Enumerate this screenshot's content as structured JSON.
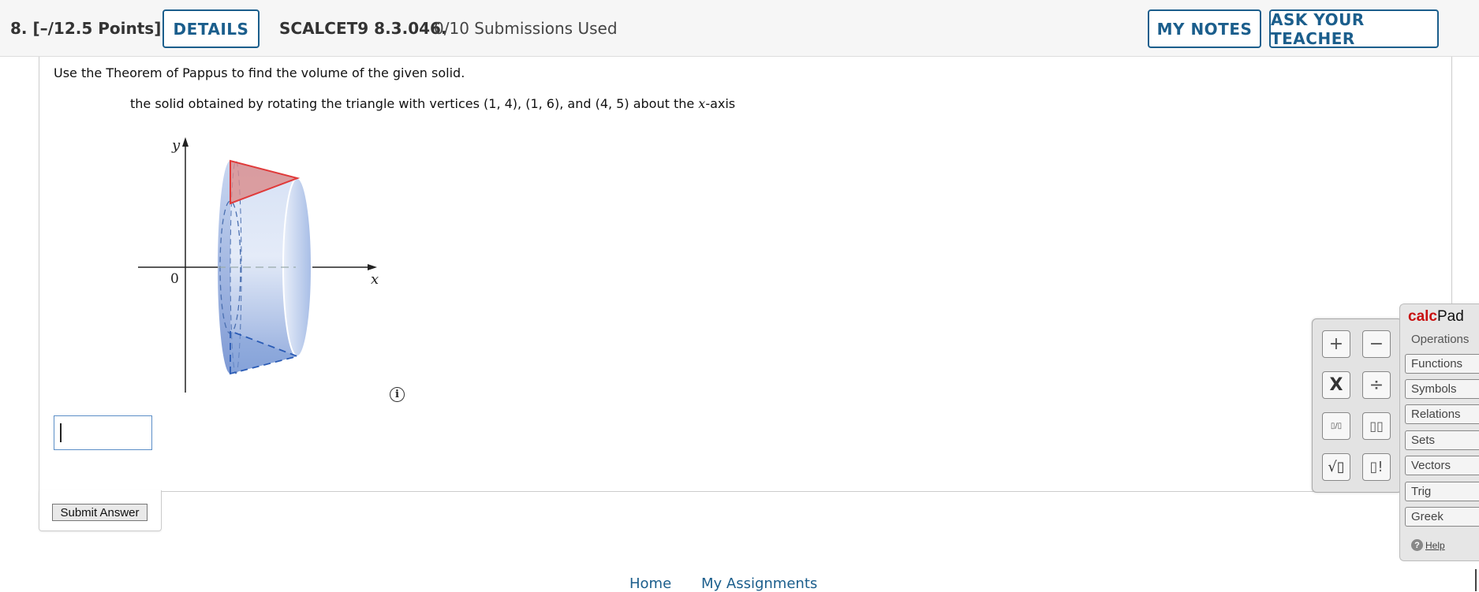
{
  "question": {
    "number_points": "8.  [–/12.5 Points]",
    "details_label": "DETAILS",
    "code": "SCALCET9 8.3.046.",
    "submissions": "0/10 Submissions Used",
    "my_notes_label": "MY NOTES",
    "ask_teacher_label": "ASK YOUR TEACHER"
  },
  "problem": {
    "instruction": "Use the Theorem of Pappus to find the volume of the given solid.",
    "statement_pre": "the solid obtained by rotating the triangle with vertices (1, 4), (1, 6), and (4, 5) about the ",
    "statement_var": "x",
    "statement_post": "-axis"
  },
  "figure": {
    "y_label": "y",
    "x_label": "x",
    "origin_label": "0"
  },
  "answer": {
    "value": ""
  },
  "submit_label": "Submit Answer",
  "footer": {
    "home": "Home",
    "assignments": "My Assignments"
  },
  "keypad": {
    "keys": [
      "+",
      "−",
      "X",
      "÷",
      "▯/▯",
      "▯▯",
      "√▯",
      "▯!"
    ]
  },
  "calcpad": {
    "title_bold": "calc",
    "title_rest": "Pad",
    "operations": "Operations",
    "items": [
      "Functions",
      "Symbols",
      "Relations",
      "Sets",
      "Vectors",
      "Trig",
      "Greek"
    ],
    "help": "Help"
  },
  "colors": {
    "accent": "#1b5e8c",
    "solid_fill": "#a9bfe6",
    "triangle_top": "#e05050",
    "triangle_bottom": "#3a6fc0"
  }
}
